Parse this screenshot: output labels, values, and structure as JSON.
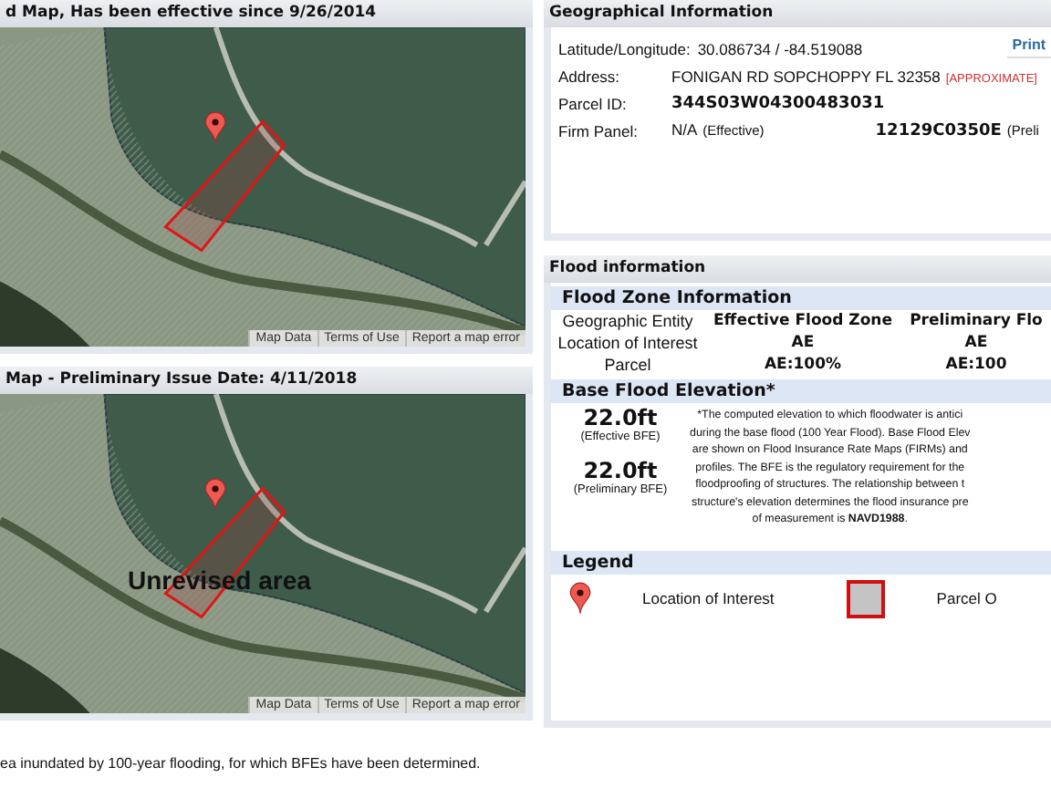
{
  "maps": [
    {
      "title": "d Map, Has been effective since 9/26/2014",
      "attribution": [
        "Map Data",
        "Terms of Use",
        "Report a map error"
      ]
    },
    {
      "title": "Map - Preliminary Issue Date: 4/11/2018",
      "overlay_label": "Unrevised area",
      "attribution": [
        "Map Data",
        "Terms of Use",
        "Report a map error"
      ]
    }
  ],
  "footer_note": "ea inundated by 100-year flooding, for which BFEs have been determined.",
  "geo_info": {
    "title": "Geographical Information",
    "print_button": "Print",
    "rows": [
      {
        "label": "Latitude/Longitude:",
        "parts": [
          {
            "kind": "text",
            "text": "30.086734 / -84.519088"
          }
        ]
      },
      {
        "label": "Address:",
        "parts": [
          {
            "kind": "text",
            "text": "FONIGAN RD SOPCHOPPY FL 32358"
          },
          {
            "kind": "tag",
            "text": "[APPROXIMATE]"
          }
        ]
      },
      {
        "label": "Parcel ID:",
        "parts": [
          {
            "kind": "bold",
            "text": "344S03W04300483031"
          }
        ]
      },
      {
        "label": "Firm Panel:",
        "parts": [
          {
            "kind": "text",
            "text": "N/A"
          },
          {
            "kind": "note",
            "text": "(Effective)"
          },
          {
            "kind": "bold",
            "text": "12129C0350E"
          },
          {
            "kind": "note",
            "text": "(Preli"
          }
        ]
      }
    ]
  },
  "flood_info": {
    "title": "Flood information",
    "zone": {
      "heading": "Flood Zone Information",
      "columns": [
        "Geographic Entity",
        "Effective Flood Zone",
        "Preliminary Flo"
      ],
      "rows": [
        [
          "Location of Interest",
          "AE",
          "AE"
        ],
        [
          "Parcel",
          "AE:100%",
          "AE:100"
        ]
      ]
    },
    "bfe": {
      "heading": "Base Flood Elevation*",
      "values": [
        {
          "value": "22.0ft",
          "caption": "(Effective BFE)"
        },
        {
          "value": "22.0ft",
          "caption": "(Preliminary BFE)"
        }
      ],
      "description_lines": [
        "*The computed elevation to which floodwater is antici",
        "during the base flood (100 Year Flood). Base Flood Elev",
        "are shown on Flood Insurance Rate Maps (FIRMs) and",
        "profiles. The BFE is the regulatory requirement for the",
        "floodproofing of structures. The relationship between t",
        "structure's elevation determines the flood insurance pre",
        "of measurement is **NAVD1988**."
      ]
    },
    "legend": {
      "heading": "Legend",
      "items": [
        {
          "kind": "pin",
          "label": "Location of Interest"
        },
        {
          "kind": "parcel",
          "label": "Parcel O"
        }
      ]
    }
  }
}
